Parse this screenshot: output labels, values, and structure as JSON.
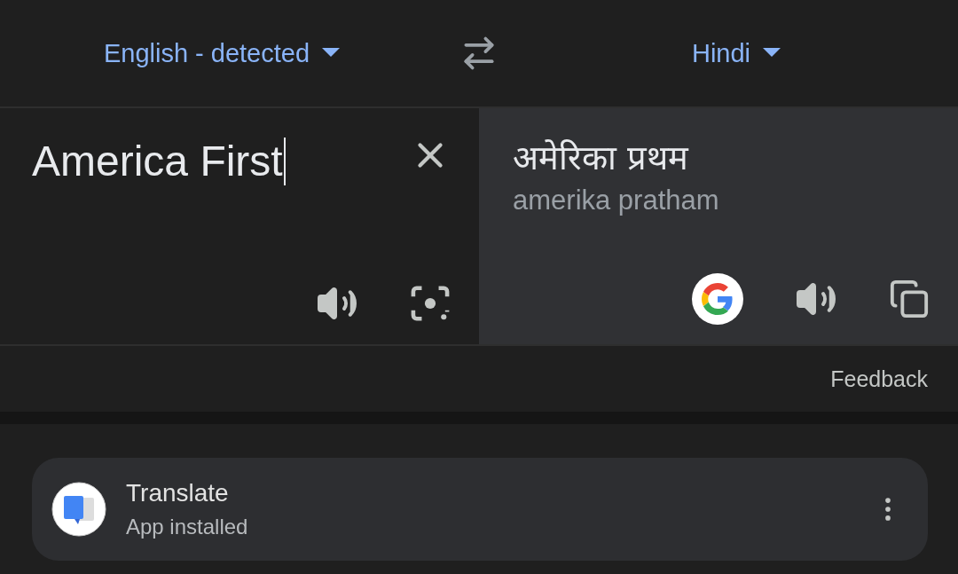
{
  "languages": {
    "source": "English - detected",
    "target": "Hindi"
  },
  "source": {
    "text": "America First"
  },
  "result": {
    "text": "अमेरिका प्रथम",
    "transliteration": "amerika pratham"
  },
  "feedback": "Feedback",
  "app_card": {
    "title": "Translate",
    "subtitle": "App installed"
  }
}
